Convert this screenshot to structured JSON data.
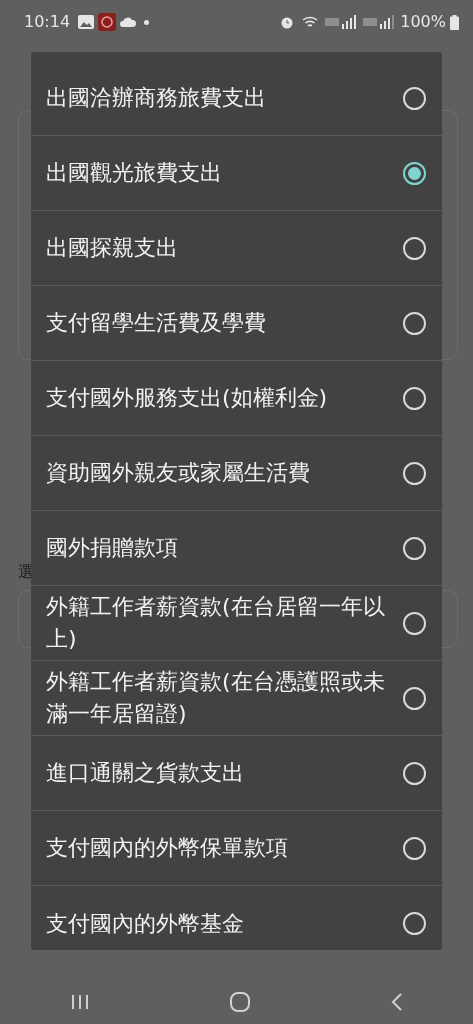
{
  "status_bar": {
    "time": "10:14",
    "battery": "100%"
  },
  "background": {
    "label": "選"
  },
  "dialog": {
    "options": [
      {
        "label": "出國洽辦商務旅費支出",
        "selected": false
      },
      {
        "label": "出國觀光旅費支出",
        "selected": true
      },
      {
        "label": "出國探親支出",
        "selected": false
      },
      {
        "label": "支付留學生活費及學費",
        "selected": false
      },
      {
        "label": "支付國外服務支出(如權利金)",
        "selected": false
      },
      {
        "label": "資助國外親友或家屬生活費",
        "selected": false
      },
      {
        "label": "國外捐贈款項",
        "selected": false
      },
      {
        "label": "外籍工作者薪資款(在台居留一年以上)",
        "selected": false
      },
      {
        "label": "外籍工作者薪資款(在台憑護照或未滿一年居留證)",
        "selected": false
      },
      {
        "label": "進口通關之貨款支出",
        "selected": false
      },
      {
        "label": "支付國內的外幣保單款項",
        "selected": false
      },
      {
        "label": "支付國內的外幣基金",
        "selected": false
      }
    ]
  }
}
